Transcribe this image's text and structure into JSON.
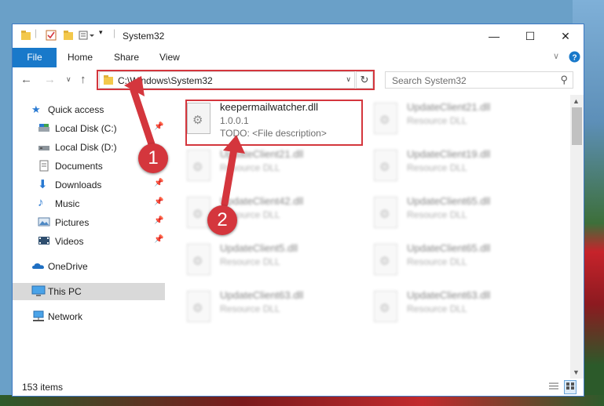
{
  "window": {
    "title": "System32",
    "controls": [
      "—",
      "☐",
      "✕"
    ]
  },
  "ribbon": {
    "tabs": [
      "File",
      "Home",
      "Share",
      "View"
    ]
  },
  "nav": {
    "address": "C:\\Windows\\System32",
    "search_placeholder": "Search System32"
  },
  "sidebar": {
    "items": [
      {
        "label": "Quick access",
        "icon": "star-icon"
      },
      {
        "label": "Local Disk (C:)",
        "icon": "drive-icon"
      },
      {
        "label": "Local Disk (D:)",
        "icon": "drive-icon"
      },
      {
        "label": "Documents",
        "icon": "documents-icon"
      },
      {
        "label": "Downloads",
        "icon": "download-icon"
      },
      {
        "label": "Music",
        "icon": "music-icon"
      },
      {
        "label": "Pictures",
        "icon": "pictures-icon"
      },
      {
        "label": "Videos",
        "icon": "videos-icon"
      },
      {
        "label": "OneDrive",
        "icon": "cloud-icon"
      },
      {
        "label": "This PC",
        "icon": "pc-icon"
      },
      {
        "label": "Network",
        "icon": "network-icon"
      }
    ]
  },
  "files": [
    {
      "name": "keepermailwatcher.dll",
      "l2": "1.0.0.1",
      "l3": "TODO: <File description>"
    },
    {
      "name": "UpdateClient21.dll",
      "l2": "Resource DLL"
    },
    {
      "name": "UpdateClient21.dll",
      "l2": "Resource DLL"
    },
    {
      "name": "UpdateClient19.dll",
      "l2": "Resource DLL"
    },
    {
      "name": "UpdateClient42.dll",
      "l2": "Resource DLL"
    },
    {
      "name": "UpdateClient65.dll",
      "l2": "Resource DLL"
    },
    {
      "name": "UpdateClient5.dll",
      "l2": "Resource DLL"
    },
    {
      "name": "UpdateClient65.dll",
      "l2": "Resource DLL"
    },
    {
      "name": "UpdateClient63.dll",
      "l2": "Resource DLL"
    },
    {
      "name": "UpdateClient63.dll",
      "l2": "Resource DLL"
    }
  ],
  "status": {
    "count": "153 items"
  },
  "badges": [
    "1",
    "2"
  ],
  "colors": {
    "accent": "#1979ca",
    "highlight": "#d4363d"
  }
}
